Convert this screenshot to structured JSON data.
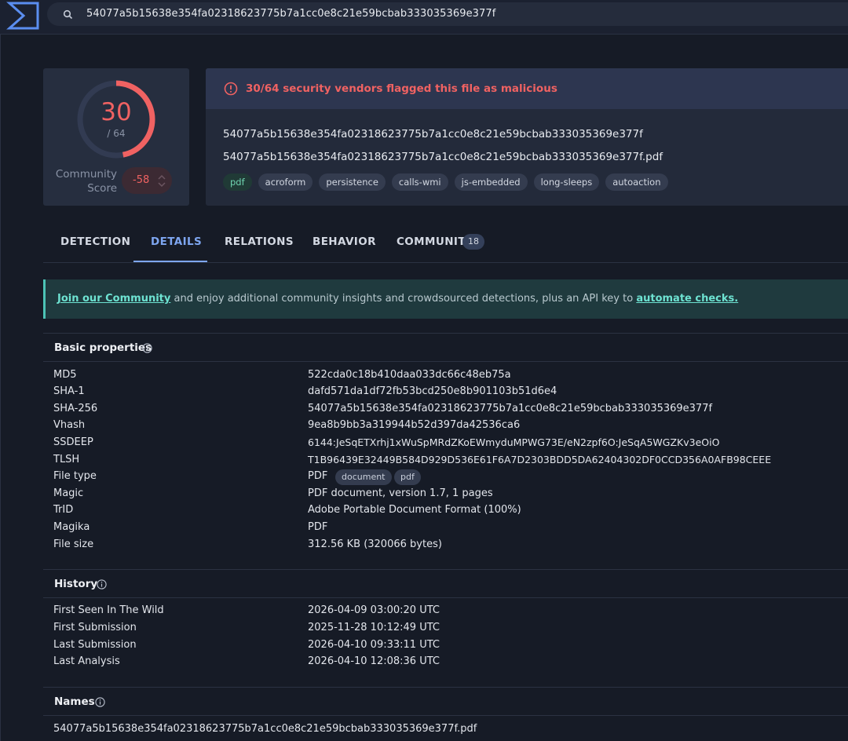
{
  "search": {
    "query": "54077a5b15638e354fa02318623775b7a1cc0e8c21e59bcbab333035369e377f"
  },
  "score": {
    "detections": "30",
    "total": "/ 64",
    "community_label_1": "Community",
    "community_label_2": "Score",
    "community_score": "-58"
  },
  "alert": {
    "text": "30/64 security vendors flagged this file as malicious"
  },
  "file": {
    "hash": "54077a5b15638e354fa02318623775b7a1cc0e8c21e59bcbab333035369e377f",
    "name": "54077a5b15638e354fa02318623775b7a1cc0e8c21e59bcbab333035369e377f.pdf",
    "tags": [
      "pdf",
      "acroform",
      "persistence",
      "calls-wmi",
      "js-embedded",
      "long-sleeps",
      "autoaction"
    ]
  },
  "tabs": {
    "detection": "DETECTION",
    "details": "DETAILS",
    "relations": "RELATIONS",
    "behavior": "BEHAVIOR",
    "community": "COMMUNITY",
    "community_count": "18"
  },
  "banner": {
    "link1": "Join our Community",
    "middle": " and enjoy additional community insights and crowdsourced detections, plus an API key to ",
    "link2": "automate checks."
  },
  "basic": {
    "title": "Basic properties",
    "rows": [
      {
        "k": "MD5",
        "v": "522cda0c18b410daa033dc66c48eb75a"
      },
      {
        "k": "SHA-1",
        "v": "dafd571da1df72fb53bcd250e8b901103b51d6e4"
      },
      {
        "k": "SHA-256",
        "v": "54077a5b15638e354fa02318623775b7a1cc0e8c21e59bcbab333035369e377f"
      },
      {
        "k": "Vhash",
        "v": "9ea8b9bb3a319944b52d397da42536ca6"
      },
      {
        "k": "SSDEEP",
        "v": "6144:JeSqETXrhj1xWuSpMRdZKoEWmyduMPWG73E/eN2zpf6O:JeSqA5WGZKv3eOiO"
      },
      {
        "k": "TLSH",
        "v": "T1B96439E32449B584D929D536E61F6A7D2303BDD5DA62404302DF0CCD356A0AFB98CEEE"
      },
      {
        "k": "File type",
        "v": "PDF"
      },
      {
        "k": "Magic",
        "v": "PDF document, version 1.7, 1 pages"
      },
      {
        "k": "TrID",
        "v": "Adobe Portable Document Format (100%)"
      },
      {
        "k": "Magika",
        "v": "PDF"
      },
      {
        "k": "File size",
        "v": "312.56 KB (320066 bytes)"
      }
    ],
    "filetype_tags": [
      "document",
      "pdf"
    ]
  },
  "history": {
    "title": "History",
    "rows": [
      {
        "k": "First Seen In The Wild",
        "v": "2026-04-09 03:00:20 UTC"
      },
      {
        "k": "First Submission",
        "v": "2025-11-28 10:12:49 UTC"
      },
      {
        "k": "Last Submission",
        "v": "2026-04-10 09:33:11 UTC"
      },
      {
        "k": "Last Analysis",
        "v": "2026-04-10 12:08:36 UTC"
      }
    ]
  },
  "names": {
    "title": "Names",
    "items": [
      "54077a5b15638e354fa02318623775b7a1cc0e8c21e59bcbab333035369e377f.pdf"
    ]
  },
  "colors": {
    "accent": "#7ea6f0",
    "danger": "#f06262",
    "teal": "#4cc3b6"
  },
  "icons": {
    "logo": "sigma-logo-icon",
    "search": "search-icon",
    "alert": "alert-circle-icon",
    "info": "info-icon"
  }
}
